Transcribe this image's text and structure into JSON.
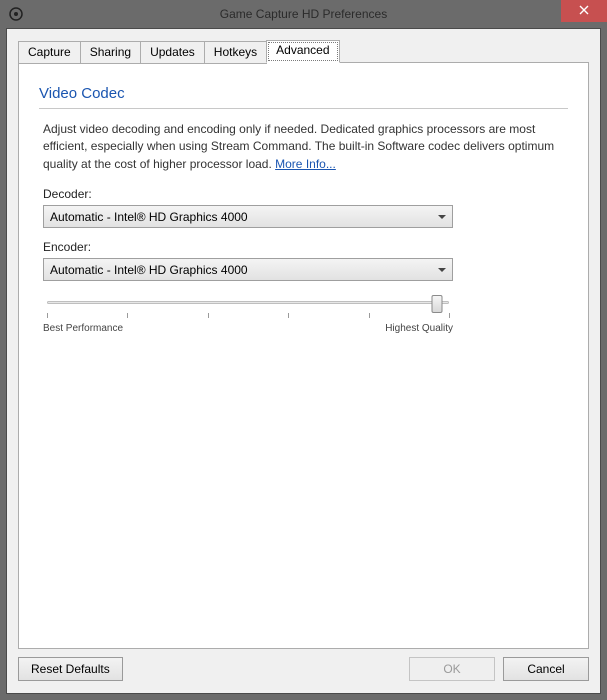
{
  "window": {
    "title": "Game Capture HD Preferences"
  },
  "tabs": [
    {
      "label": "Capture"
    },
    {
      "label": "Sharing"
    },
    {
      "label": "Updates"
    },
    {
      "label": "Hotkeys"
    },
    {
      "label": "Advanced",
      "active": true
    }
  ],
  "section": {
    "title": "Video Codec",
    "description_pre": "Adjust video decoding and encoding only if needed. Dedicated graphics processors are most efficient, especially when using Stream Command. The built-in Software codec delivers optimum quality at the cost of higher processor load. ",
    "more_info": "More Info..."
  },
  "decoder": {
    "label": "Decoder:",
    "value": "Automatic - Intel® HD Graphics 4000"
  },
  "encoder": {
    "label": "Encoder:",
    "value": "Automatic - Intel® HD Graphics 4000"
  },
  "slider": {
    "min_label": "Best Performance",
    "max_label": "Highest Quality",
    "value_percent": 96
  },
  "buttons": {
    "reset": "Reset Defaults",
    "ok": "OK",
    "cancel": "Cancel"
  }
}
